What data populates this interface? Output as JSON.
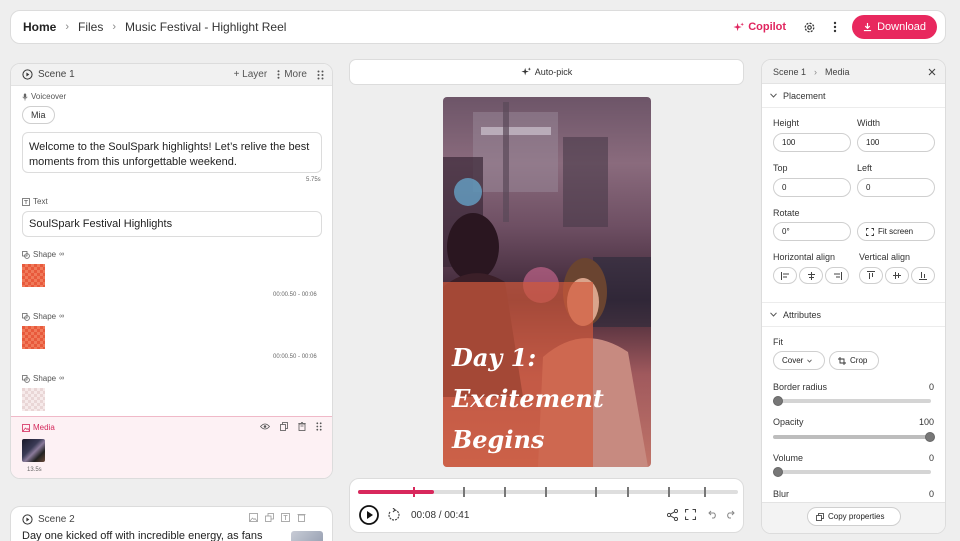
{
  "breadcrumb": {
    "home": "Home",
    "files": "Files",
    "project": "Music Festival - Highlight Reel"
  },
  "topbar": {
    "copilot": "Copilot",
    "download": "Download"
  },
  "scene1": {
    "title": "Scene 1",
    "add_layer": "+ Layer",
    "more": "More",
    "voiceover": {
      "label": "Voiceover",
      "voice": "Mia",
      "text": "Welcome to the SoulSpark highlights! Let’s relive the best moments from this unforgettable weekend.",
      "duration": "5.75s"
    },
    "text_layer": {
      "label": "Text",
      "value": "SoulSpark Festival Highlights"
    },
    "shapes": [
      {
        "label": "Shape",
        "time": "00:00.50 - 00:06"
      },
      {
        "label": "Shape",
        "time": "00:00.50 - 00:06"
      },
      {
        "label": "Shape",
        "time": ""
      }
    ],
    "media": {
      "label": "Media",
      "duration": "13.5s"
    }
  },
  "scene2": {
    "title": "Scene 2",
    "text": "Day one kicked off with incredible energy, as fans"
  },
  "center": {
    "autopick": "Auto-pick",
    "video_text": [
      "Day 1:",
      "Excitement",
      "Begins"
    ],
    "player": {
      "current": "00:08",
      "total": "00:41",
      "separator": " / ",
      "progress": 0.2
    }
  },
  "properties": {
    "breadcrumb_scene": "Scene 1",
    "breadcrumb_item": "Media",
    "placement_title": "Placement",
    "height_label": "Height",
    "height": "100",
    "width_label": "Width",
    "width": "100",
    "top_label": "Top",
    "top": "0",
    "left_label": "Left",
    "left": "0",
    "rotate_label": "Rotate",
    "rotate": "0°",
    "fit_screen": "Fit screen",
    "halign_label": "Horizontal align",
    "valign_label": "Vertical align",
    "attributes_title": "Attributes",
    "fit_label": "Fit",
    "fit_value": "Cover",
    "crop": "Crop",
    "border_radius_label": "Border radius",
    "border_radius": "0",
    "opacity_label": "Opacity",
    "opacity": "100",
    "volume_label": "Volume",
    "volume": "0",
    "blur_label": "Blur",
    "blur": "0",
    "copy_properties": "Copy properties"
  },
  "colors": {
    "accent": "#e8285e",
    "panel_bg": "#ffffff",
    "page_bg": "#eeeeee"
  }
}
